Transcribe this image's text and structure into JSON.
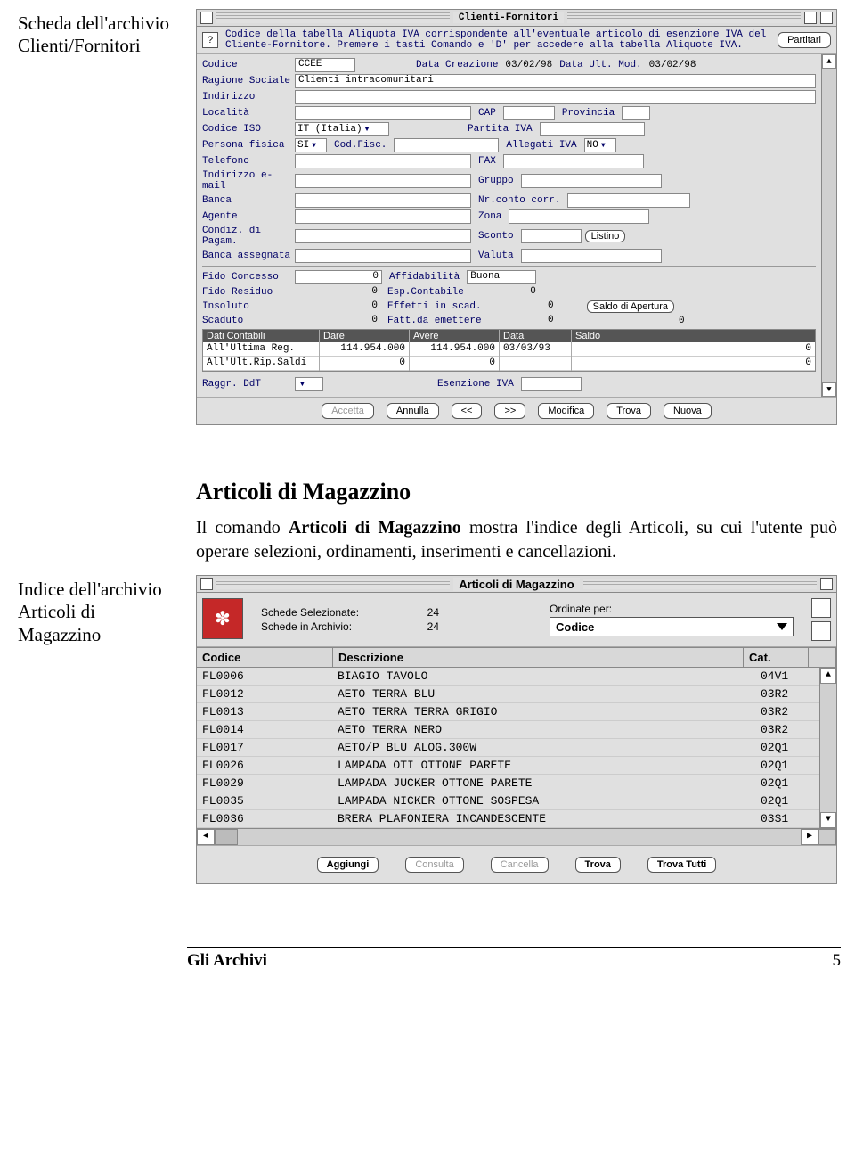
{
  "margin1": "Scheda dell'archivio Clienti/Fornitori",
  "margin2": "Indice dell'archivio Articoli di Magazzino",
  "cf": {
    "title": "Clienti-Fornitori",
    "hint": "Codice della tabella Aliquota IVA corrispondente all'eventuale articolo di esenzione IVA del Cliente-Fornitore. Premere i tasti Comando e 'D' per accedere alla tabella Aliquote IVA.",
    "partitari": "Partitari",
    "labels": {
      "codice": "Codice",
      "dataCreaz": "Data Creazione",
      "dataMod": "Data Ult. Mod.",
      "ragione": "Ragione Sociale",
      "indirizzo": "Indirizzo",
      "localita": "Località",
      "cap": "CAP",
      "prov": "Provincia",
      "codiceIso": "Codice ISO",
      "partitaIva": "Partita IVA",
      "persFisica": "Persona fisica",
      "codFisc": "Cod.Fisc.",
      "allegati": "Allegati IVA",
      "telefono": "Telefono",
      "fax": "FAX",
      "email": "Indirizzo e-mail",
      "gruppo": "Gruppo",
      "banca": "Banca",
      "nrConto": "Nr.conto corr.",
      "agente": "Agente",
      "zona": "Zona",
      "condiz": "Condiz. di Pagam.",
      "sconto": "Sconto",
      "listino": "Listino",
      "bancaAss": "Banca assegnata",
      "valuta": "Valuta",
      "fidoConc": "Fido Concesso",
      "affid": "Affidabilità",
      "fidoRes": "Fido Residuo",
      "espCont": "Esp.Contabile",
      "insoluto": "Insoluto",
      "effetti": "Effetti in scad.",
      "scaduto": "Scaduto",
      "fattEm": "Fatt.da emettere",
      "saldoAp": "Saldo di Apertura",
      "raggr": "Raggr. DdT",
      "esenzione": "Esenzione IVA"
    },
    "values": {
      "codice": "CCEE",
      "dataCreaz": "03/02/98",
      "dataMod": "03/02/98",
      "ragione": "Clienti intracomunitari",
      "codiceIso": "IT (Italia)",
      "persFisica": "SI",
      "allegati": "NO",
      "fidoConc": "0",
      "affid": "Buona",
      "fidoRes": "0",
      "espCont": "0",
      "insoluto": "0",
      "effetti": "0",
      "scaduto": "0",
      "fattEm": "0",
      "saldoAp": "0"
    },
    "grid": {
      "h1": "Dati Contabili",
      "h2": "Dare",
      "h3": "Avere",
      "h4": "Data",
      "h5": "Saldo",
      "r1c1": "All'Ultima Reg.",
      "r1c2": "114.954.000",
      "r1c3": "114.954.000",
      "r1c4": "03/03/93",
      "r1c5": "0",
      "r2c1": "All'Ult.Rip.Saldi",
      "r2c2": "0",
      "r2c3": "0",
      "r2c4": "",
      "r2c5": "0"
    },
    "btns": {
      "accetta": "Accetta",
      "annulla": "Annulla",
      "prev": "<<",
      "next": ">>",
      "modifica": "Modifica",
      "trova": "Trova",
      "nuova": "Nuova"
    }
  },
  "art": {
    "heading": "Articoli di Magazzino",
    "text1": "Il comando ",
    "textBold": "Articoli di Magazzino",
    "text2": " mostra l'indice degli Articoli, su cui l'utente può operare selezioni, ordinamenti, inserimenti e cancellazioni.",
    "title": "Articoli di Magazzino",
    "sum": {
      "selLbl": "Schede Selezionate:",
      "selVal": "24",
      "archLbl": "Schede in Archivio:",
      "archVal": "24",
      "ordLbl": "Ordinate per:",
      "ordVal": "Codice"
    },
    "hdr": {
      "cod": "Codice",
      "desc": "Descrizione",
      "cat": "Cat."
    },
    "rows": [
      {
        "c": "FL0006",
        "d": "BIAGIO TAVOLO",
        "k": "04V1"
      },
      {
        "c": "FL0012",
        "d": "AETO TERRA BLU",
        "k": "03R2"
      },
      {
        "c": "FL0013",
        "d": "AETO TERRA TERRA GRIGIO",
        "k": "03R2"
      },
      {
        "c": "FL0014",
        "d": "AETO TERRA NERO",
        "k": "03R2"
      },
      {
        "c": "FL0017",
        "d": "AETO/P BLU ALOG.300W",
        "k": "02Q1"
      },
      {
        "c": "FL0026",
        "d": "LAMPADA OTI OTTONE PARETE",
        "k": "02Q1"
      },
      {
        "c": "FL0029",
        "d": "LAMPADA JUCKER OTTONE PARETE",
        "k": "02Q1"
      },
      {
        "c": "FL0035",
        "d": "LAMPADA NICKER OTTONE SOSPESA",
        "k": "02Q1"
      },
      {
        "c": "FL0036",
        "d": "BRERA PLAFONIERA INCANDESCENTE",
        "k": "03S1"
      }
    ],
    "btns": {
      "aggiungi": "Aggiungi",
      "consulta": "Consulta",
      "cancella": "Cancella",
      "trova": "Trova",
      "trovaTutti": "Trova Tutti"
    }
  },
  "footer": {
    "title": "Gli Archivi",
    "page": "5"
  }
}
